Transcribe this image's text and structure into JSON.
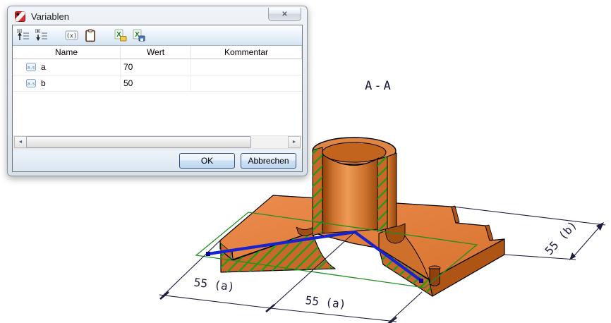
{
  "window": {
    "title": "Variablen",
    "close_glyph": "✕"
  },
  "toolbar": {
    "icons": [
      {
        "name": "move-variable-up-icon"
      },
      {
        "name": "move-variable-down-icon"
      },
      {
        "name": "formula-icon",
        "glyph": "(x)"
      },
      {
        "name": "clipboard-icon"
      },
      {
        "name": "excel-import-icon",
        "glyph": "X"
      },
      {
        "name": "excel-export-icon",
        "glyph": "X"
      }
    ]
  },
  "table": {
    "columns": [
      "Name",
      "Wert",
      "Kommentar"
    ],
    "rows": [
      {
        "name": "a",
        "wert": "70",
        "kommentar": ""
      },
      {
        "name": "b",
        "wert": "50",
        "kommentar": ""
      }
    ]
  },
  "scrollbar": {
    "left_arrow": "◄",
    "right_arrow": "►"
  },
  "buttons": {
    "ok": "OK",
    "cancel": "Abbrechen"
  },
  "drawing": {
    "section_label": "A-A",
    "dim_bottom_left": "55 (a)",
    "dim_bottom_right": "55 (a)",
    "dim_right": "55 (b)",
    "colors": {
      "part_orange": "#DD7B38",
      "part_dark": "#AE5414",
      "hatch_green": "#14A014",
      "plane_green": "#1F8F1F",
      "section_blue": "#1822CF",
      "dimension_navy": "#1B1B3C"
    }
  }
}
